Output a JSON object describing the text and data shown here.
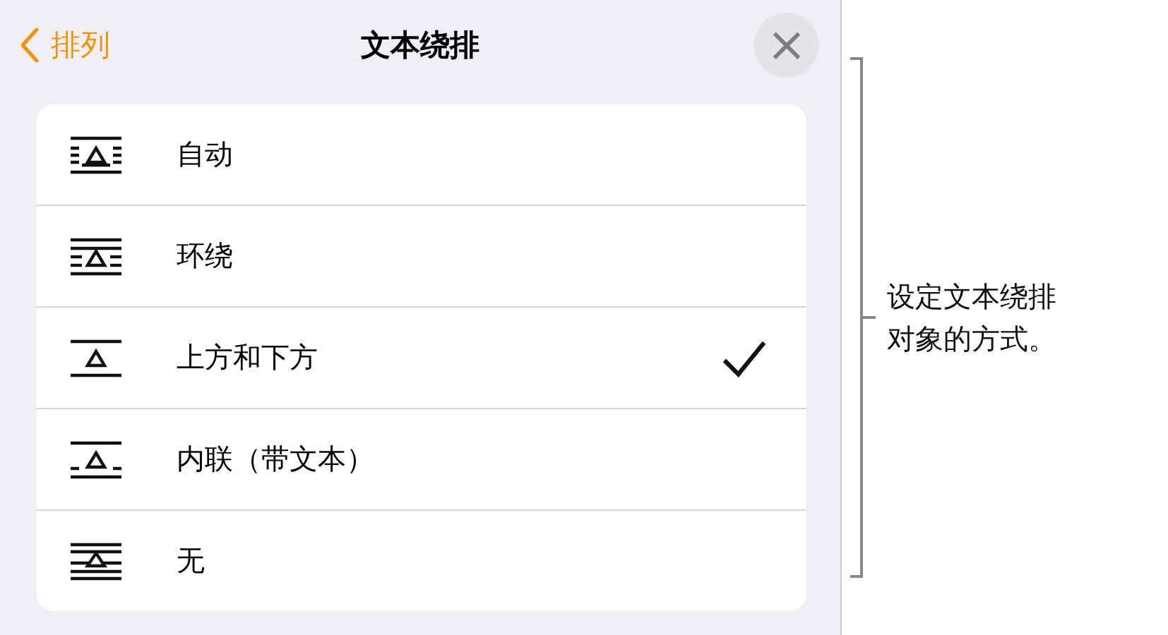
{
  "header": {
    "back_label": "排列",
    "title": "文本绕排",
    "close": "×"
  },
  "options": [
    {
      "kind": "auto",
      "label": "自动",
      "selected": false
    },
    {
      "kind": "around",
      "label": "环绕",
      "selected": false
    },
    {
      "kind": "above_below",
      "label": "上方和下方",
      "selected": true
    },
    {
      "kind": "inline",
      "label": "内联（带文本）",
      "selected": false
    },
    {
      "kind": "none",
      "label": "无",
      "selected": false
    }
  ],
  "callout": "设定文本绕排对象的方式。"
}
